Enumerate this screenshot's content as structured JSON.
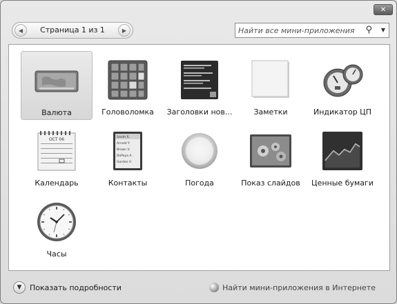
{
  "window": {
    "close_label": "✕"
  },
  "pager": {
    "label": "Страница 1 из 1",
    "prev_icon": "chevron-left-icon",
    "next_icon": "chevron-right-icon"
  },
  "search": {
    "placeholder": "Найти все мини-приложения",
    "icon": "search-icon"
  },
  "gadgets": [
    {
      "label": "Валюта",
      "icon": "currency-icon",
      "selected": true
    },
    {
      "label": "Головоломка",
      "icon": "puzzle-icon"
    },
    {
      "label": "Заголовки нов...",
      "icon": "news-headlines-icon"
    },
    {
      "label": "Заметки",
      "icon": "notes-icon"
    },
    {
      "label": "Индикатор ЦП",
      "icon": "cpu-meter-icon"
    },
    {
      "label": "Календарь",
      "icon": "calendar-icon",
      "month": "OCT 06"
    },
    {
      "label": "Контакты",
      "icon": "contacts-icon",
      "names": [
        "Smith R.",
        "Arnold Y.",
        "Brown V.",
        "DePaya A.",
        "Gordon V."
      ]
    },
    {
      "label": "Погода",
      "icon": "weather-icon"
    },
    {
      "label": "Показ слайдов",
      "icon": "slideshow-icon"
    },
    {
      "label": "Ценные бумаги",
      "icon": "stocks-icon"
    },
    {
      "label": "Часы",
      "icon": "clock-icon"
    }
  ],
  "footer": {
    "details_label": "Показать подробности",
    "online_label": "Найти мини-приложения в Интернете"
  }
}
